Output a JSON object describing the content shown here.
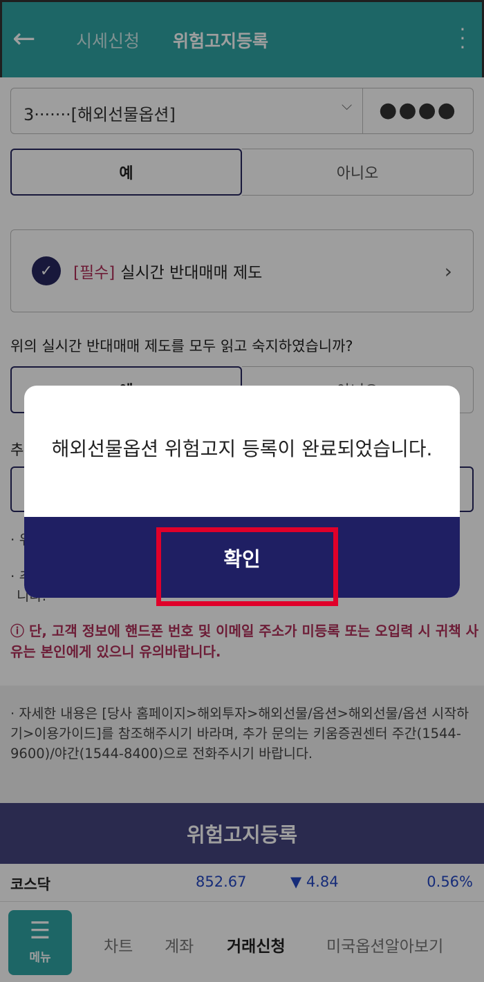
{
  "header": {
    "back_icon": "arrow-left-icon",
    "tabs": [
      {
        "label": "시세신청"
      },
      {
        "label": "위험고지등록"
      }
    ],
    "more_icon": "kebab-icon",
    "color": "#2fa5a5"
  },
  "account": {
    "value": "3·······[해외선물옵션]",
    "password": "●●●●"
  },
  "first_choice": {
    "yes": "예",
    "no": "아니오"
  },
  "notice_card": {
    "required": "[필수]",
    "title": "실시간 반대매매 제도"
  },
  "question": "위의 실시간 반대매매 제도를 모두 읽고 숙지하였습니까?",
  "second_choice": {
    "yes": "예",
    "no": "아니오"
  },
  "hidden_label": "추",
  "bullets": [
    "· 위",
    "· 추",
    "니다."
  ],
  "warning": {
    "icon": "exclamation-circle-icon",
    "text": "단, 고객 정보에 핸드폰 번호 및 이메일 주소가 미등록 또는 오입력 시 귀책 사유는 본인에게 있으니 유의바랍니다."
  },
  "info": "· 자세한 내용은 [당사 홈페이지>해외투자>해외선물/옵션>해외선물/옵션 시작하기>이용가이드]를 참조해주시기 바라며, 추가 문의는 키움증권센터 주간(1544-9600)/야간(1544-8400)으로 전화주시기 바랍니다.",
  "submit_button": "위험고지등록",
  "ticker": {
    "name": "코스닥",
    "price": "852.67",
    "change": "▼ 4.84",
    "percent": "0.56%"
  },
  "bottom_nav": {
    "menu": "메뉴",
    "items": [
      "차트",
      "계좌",
      "거래신청",
      "미국옵션알아보기"
    ],
    "active": "거래신청"
  },
  "modal": {
    "message": "해외선물옵션 위험고지 등록이 완료되었습니다.",
    "confirm": "확인",
    "highlight_color": "#e0002a"
  }
}
